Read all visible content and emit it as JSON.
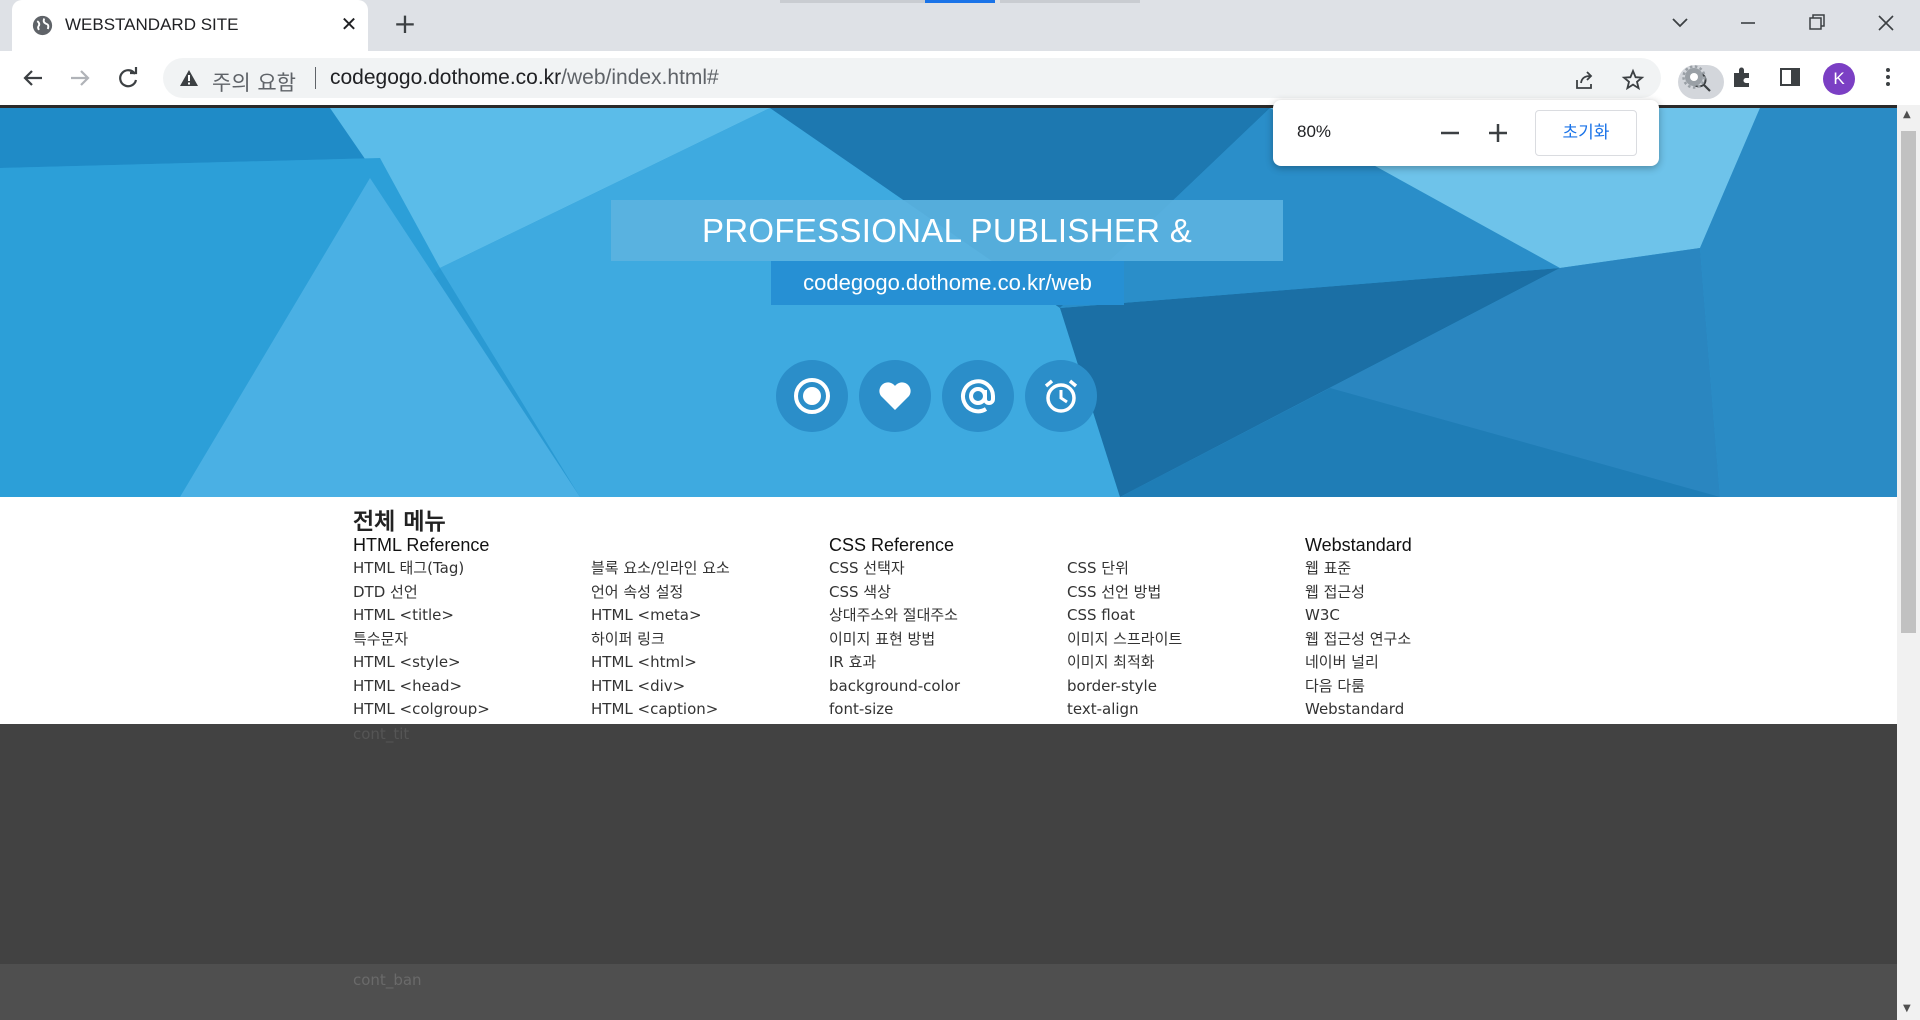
{
  "browser": {
    "tab_title": "WEBSTANDARD SITE",
    "tab_close": "✕",
    "new_tab": "+",
    "security_label": "주의 요함",
    "url_host": "codegogo.dothome.co.kr",
    "url_path": "/web/index.html#",
    "avatar_letter": "K",
    "zoom": {
      "level": "80%",
      "reset_label": "초기화"
    }
  },
  "hero": {
    "title": "PROFESSIONAL PUBLISHER & DESIGNER",
    "subtitle": "codegogo.dothome.co.kr/web",
    "icons": [
      "record-icon",
      "heart-icon",
      "at-sign-icon",
      "alarm-clock-icon"
    ]
  },
  "menu": {
    "title": "전체 메뉴",
    "columns": [
      {
        "heading": "HTML Reference",
        "items": [
          "HTML 태그(Tag)",
          "DTD 선언",
          "HTML <title>",
          "특수문자",
          "HTML <style>",
          "HTML <head>",
          "HTML <colgroup>"
        ]
      },
      {
        "heading": "",
        "items": [
          "블록 요소/인라인 요소",
          "언어 속성 설정",
          "HTML <meta>",
          "하이퍼 링크",
          "HTML <html>",
          "HTML <div>",
          "HTML <caption>"
        ]
      },
      {
        "heading": "CSS Reference",
        "items": [
          "CSS 선택자",
          "CSS 색상",
          "상대주소와 절대주소",
          "이미지 표현 방법",
          "IR 효과",
          "background-color",
          "font-size"
        ]
      },
      {
        "heading": "",
        "items": [
          "CSS 단위",
          "CSS 선언 방법",
          "CSS float",
          "이미지 스프라이트",
          "이미지 최적화",
          "border-style",
          "text-align"
        ]
      },
      {
        "heading": "Webstandard",
        "items": [
          "웹 표준",
          "웹 접근성",
          "W3C",
          "웹 접근성 연구소",
          "네이버 널리",
          "다음 다룸",
          "Webstandard"
        ]
      }
    ]
  },
  "sections": {
    "cont_tit": "cont_tit",
    "cont_ban": "cont_ban"
  },
  "colors": {
    "hero_blue": "#2a9ad3",
    "content_dark": "#424242",
    "link_blue": "#1a73e8",
    "avatar_purple": "#7b3fc4"
  }
}
